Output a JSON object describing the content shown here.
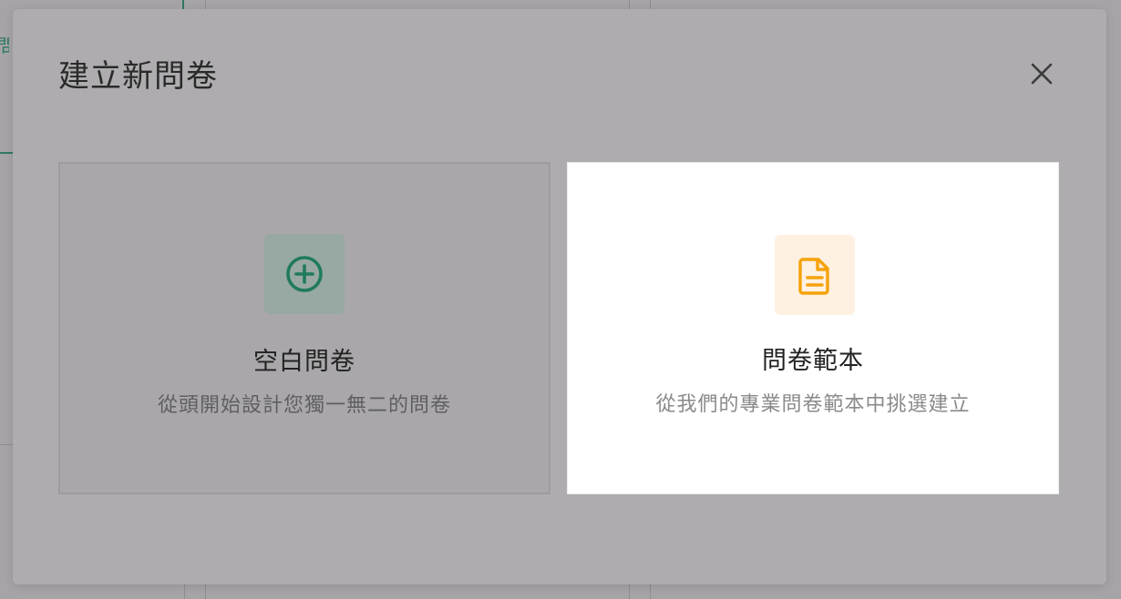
{
  "background": {
    "fragment_char": "問"
  },
  "modal": {
    "title": "建立新問卷",
    "close_label": "✕"
  },
  "options": [
    {
      "key": "blank",
      "title": "空白問卷",
      "description": "從頭開始設計您獨一無二的問卷",
      "icon": "plus-circle-icon",
      "icon_color": "#1f7a5e"
    },
    {
      "key": "template",
      "title": "問卷範本",
      "description": "從我們的專業問卷範本中挑選建立",
      "icon": "document-icon",
      "icon_color": "#f5a20a"
    }
  ]
}
